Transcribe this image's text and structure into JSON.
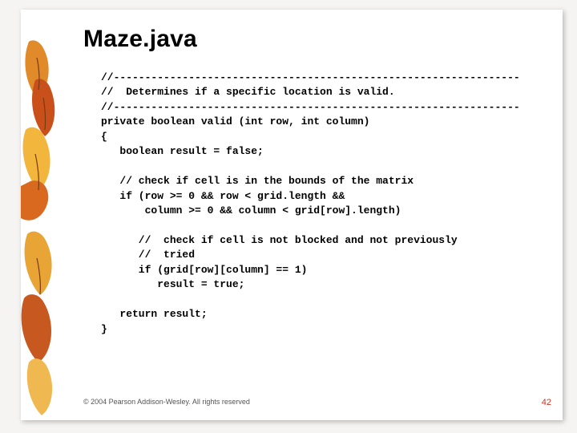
{
  "title": "Maze.java",
  "code": {
    "l01": "//-----------------------------------------------------------------",
    "l02": "//  Determines if a specific location is valid.",
    "l03": "//-----------------------------------------------------------------",
    "l04": "private boolean valid (int row, int column)",
    "l05": "{",
    "l06": "   boolean result = false;",
    "l07": "",
    "l08": "   // check if cell is in the bounds of the matrix",
    "l09": "   if (row >= 0 && row < grid.length &&",
    "l10": "       column >= 0 && column < grid[row].length)",
    "l11": "",
    "l12": "      //  check if cell is not blocked and not previously",
    "l13": "      //  tried",
    "l14": "      if (grid[row][column] == 1)",
    "l15": "         result = true;",
    "l16": "",
    "l17": "   return result;",
    "l18": "}"
  },
  "footer": "© 2004 Pearson Addison-Wesley. All rights reserved",
  "pagenum": "42"
}
